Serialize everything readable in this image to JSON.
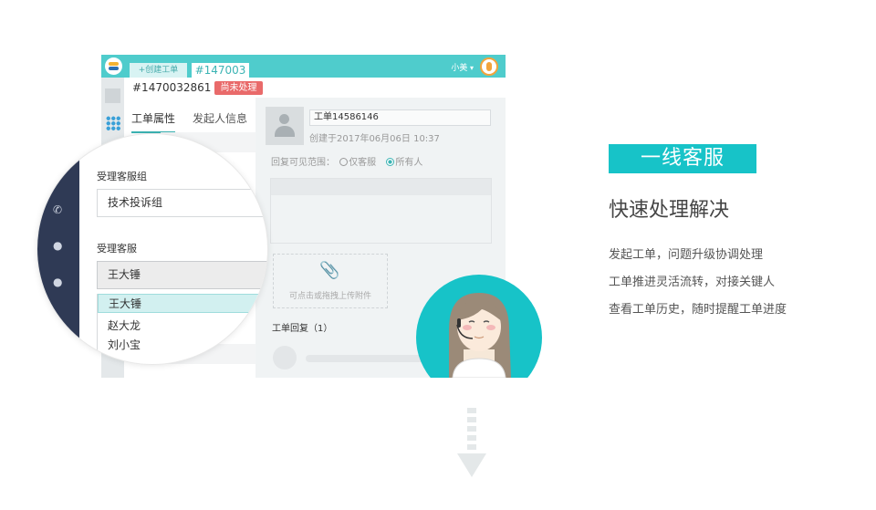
{
  "app": {
    "create_button": "+创建工单",
    "active_tab": "#147003",
    "user_name": "小美",
    "ticket_id": "#1470032861",
    "status_badge": "尚未处理",
    "tabs": [
      "工单属性",
      "发起人信息"
    ]
  },
  "ticket": {
    "title": "工单14586146",
    "created_at": "创建于2017年06月06日 10:37",
    "reply_scope_label": "回复可见范围：",
    "scope_options": [
      "仅客服",
      "所有人"
    ],
    "scope_selected": "所有人",
    "upload_hint": "可点击或拖拽上传附件",
    "replies_label": "工单回复（1）"
  },
  "magnifier": {
    "group_label": "受理客服组",
    "group_value": "技术投诉组",
    "agent_label": "受理客服",
    "agent_value": "王大锤",
    "agent_options": [
      "王大锤",
      "赵大龙",
      "刘小宝"
    ]
  },
  "feature": {
    "tag": "一线客服",
    "headline": "快速处理解决",
    "points": [
      "发起工单，问题升级协调处理",
      "工单推进灵活流转，对接关键人",
      "查看工单历史，随时提醒工单进度"
    ]
  },
  "colors": {
    "brand_teal": "#4fcccc",
    "tag_teal": "#17c3c8",
    "status_red": "#e96a6a",
    "nav_dark": "#2f3a55"
  }
}
